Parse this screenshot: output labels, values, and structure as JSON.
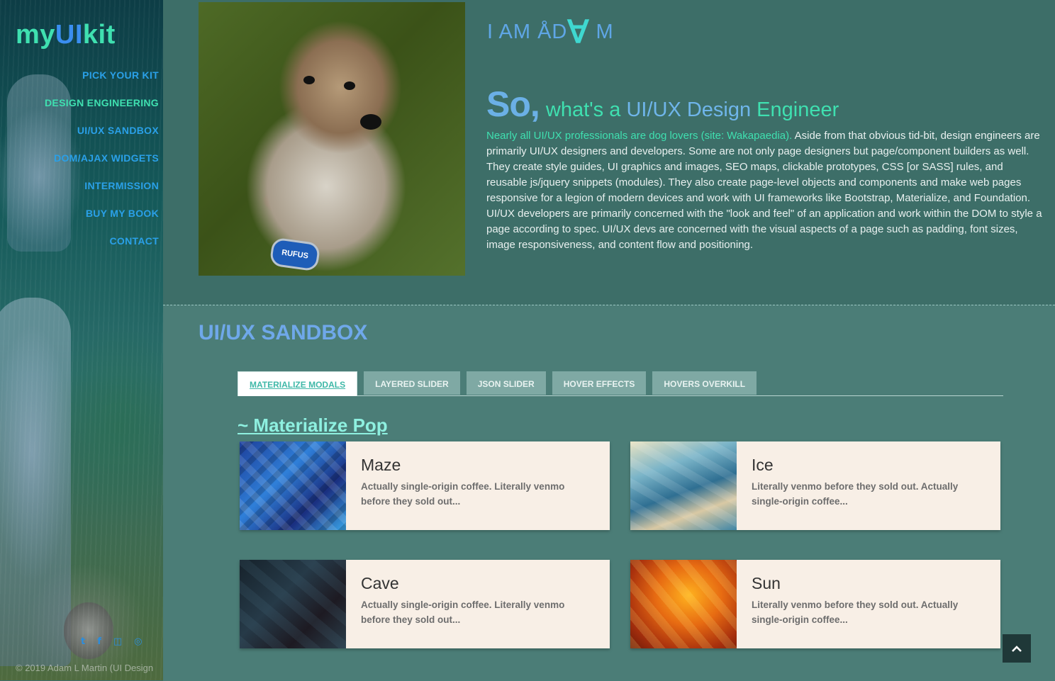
{
  "sidebar": {
    "logo": {
      "part1": "my",
      "part2": "UI",
      "part3": "kit"
    },
    "nav": [
      {
        "label": "PICK YOUR KIT"
      },
      {
        "label": "DESIGN ENGINEERING"
      },
      {
        "label": "UI/UX SANDBOX"
      },
      {
        "label": "DOM/AJAX WIDGETS"
      },
      {
        "label": "INTERMISSION"
      },
      {
        "label": "BUY MY BOOK"
      },
      {
        "label": "CONTACT"
      }
    ],
    "social_icons": [
      "twitter-icon",
      "facebook-icon",
      "instagram-icon",
      "dribbble-icon"
    ],
    "copyright": "© 2019 Adam L Martin (UI Design"
  },
  "hero": {
    "dog_tag": "RUFUS",
    "iam": {
      "pre": "I AM ÅD",
      "big": "∀",
      "post": " M"
    },
    "headline": {
      "so": "So,",
      "rest_a": "what's a ",
      "rest_b": "UI/UX Design",
      "rest_c": " Engineer"
    },
    "intro_lead": "Nearly all UI/UX professionals are dog lovers (site: Wakapaedia).",
    "intro_body": " Aside from that obvious tid-bit, design engineers are primarily UI/UX designers and developers. Some are not only page designers but page/component builders as well. They create style guides, UI graphics and images, SEO maps, clickable prototypes, CSS [or SASS] rules, and reusable js/jquery snippets (modules). They also create page-level objects and components and make web pages responsive for a legion of modern devices and work with UI frameworks like Bootstrap, Materialize, and Foundation. UI/UX developers are primarily concerned with the \"look and feel\" of an application and work within the DOM to style a page according to spec. UI/UX devs are concerned with the visual aspects of a page such as padding, font sizes, image responsiveness, and content flow and positioning."
  },
  "sandbox": {
    "title": "UI/UX SANDBOX",
    "tabs": [
      {
        "label": "MATERIALIZE MODALS"
      },
      {
        "label": "LAYERED SLIDER"
      },
      {
        "label": "JSON SLIDER"
      },
      {
        "label": "HOVER EFFECTS"
      },
      {
        "label": "HOVERS OVERKILL"
      }
    ],
    "section_title": "~ Materialize Pop",
    "cards": [
      {
        "title": "Maze",
        "desc": "Actually single-origin coffee. Literally venmo before they sold out..."
      },
      {
        "title": "Ice",
        "desc": "Literally venmo before they sold out. Actually single-origin coffee..."
      },
      {
        "title": "Cave",
        "desc": "Actually single-origin coffee. Literally venmo before they sold out..."
      },
      {
        "title": "Sun",
        "desc": "Literally venmo before they sold out. Actually single-origin coffee..."
      }
    ]
  },
  "back_to_top_icon": "chevron-up-icon"
}
